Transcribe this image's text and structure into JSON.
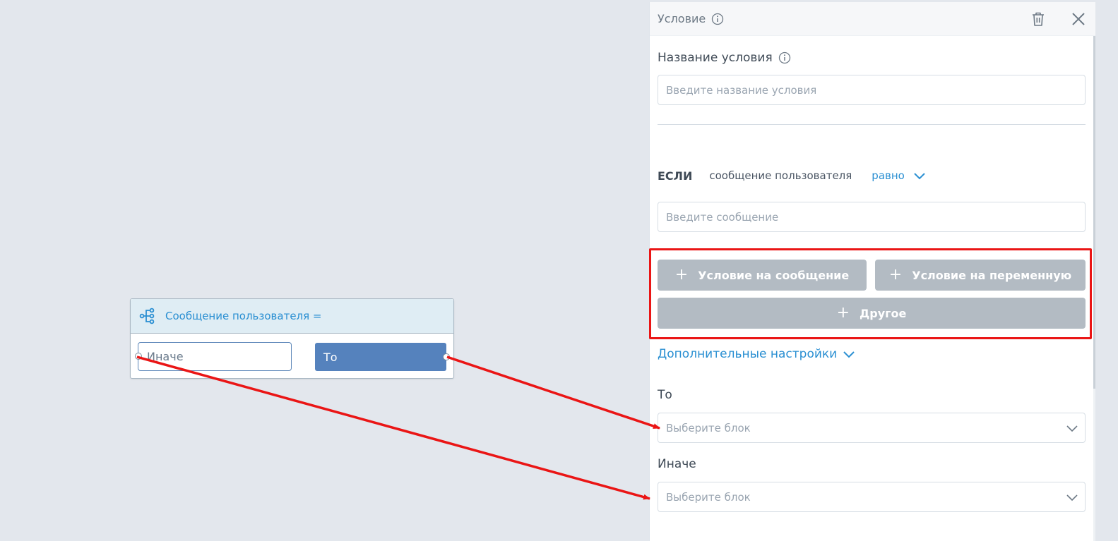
{
  "canvas": {
    "node": {
      "title": "Сообщение пользователя =",
      "icon": "flow-branch-icon",
      "else_label": "Иначе",
      "then_label": "То"
    }
  },
  "panel": {
    "header": {
      "title": "Условие",
      "icons": [
        "info-icon",
        "trash-icon",
        "close-icon"
      ]
    },
    "condition_name": {
      "label": "Название условия",
      "placeholder": "Введите название условия"
    },
    "condition": {
      "if_keyword": "ЕСЛИ",
      "subject": "сообщение пользователя",
      "operator": "равно",
      "value_placeholder": "Введите сообщение"
    },
    "add_buttons": {
      "message_condition": "Условие на сообщение",
      "variable_condition": "Условие на переменную",
      "other": "Другое"
    },
    "advanced_settings": "Дополнительные настройки",
    "then": {
      "label": "То",
      "placeholder": "Выберите блок"
    },
    "else": {
      "label": "Иначе",
      "placeholder": "Выберите блок"
    }
  },
  "colors": {
    "accent": "#2a8fd2",
    "node_then_bg": "#5582bd",
    "button_grey": "#b3bbc3",
    "annotation_red": "#ea1515",
    "canvas_bg": "#e3e7ed"
  }
}
